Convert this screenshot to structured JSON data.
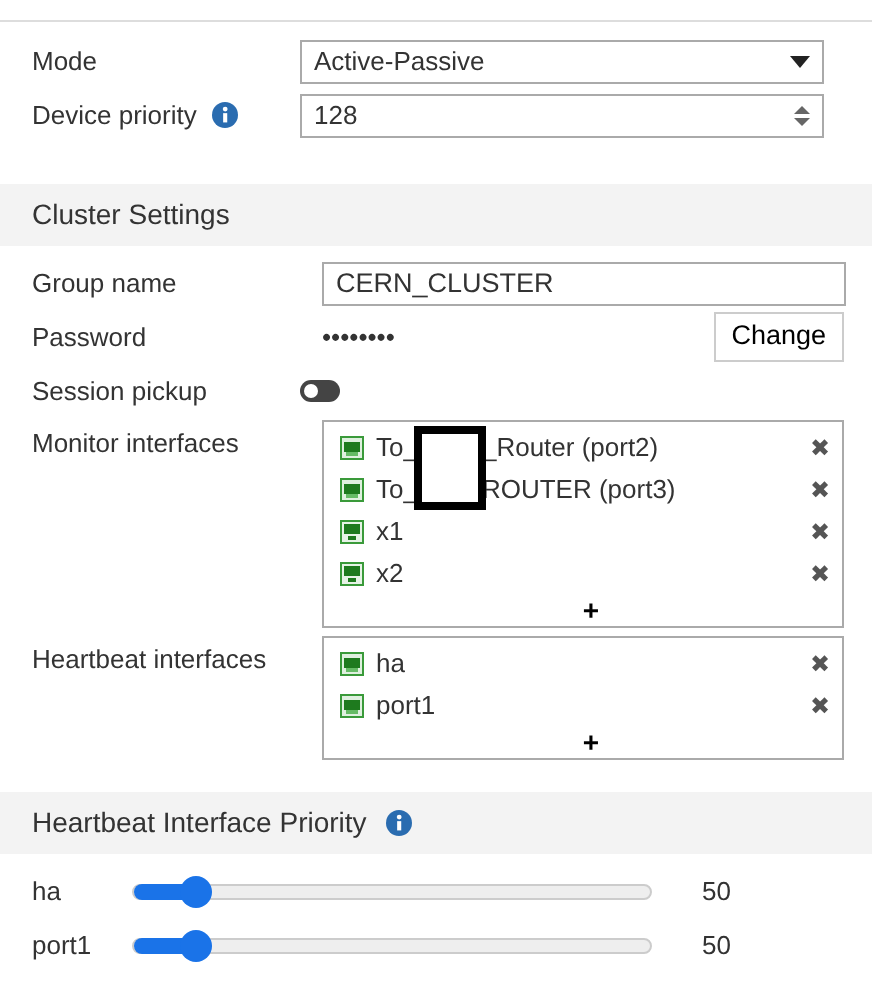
{
  "ha_settings": {
    "mode": {
      "label": "Mode",
      "value": "Active-Passive"
    },
    "device_priority": {
      "label": "Device priority",
      "value": "128"
    }
  },
  "cluster_settings": {
    "title": "Cluster Settings",
    "group_name": {
      "label": "Group name",
      "value": "CERN_CLUSTER"
    },
    "password": {
      "label": "Password",
      "value": "••••••••",
      "button": "Change"
    },
    "session_pickup": {
      "label": "Session pickup",
      "on": false
    },
    "monitor_interfaces": {
      "label": "Monitor interfaces",
      "add": "+",
      "items": [
        {
          "kind": "port",
          "before": "To_",
          "after": "_Router (port2)",
          "redacted": true,
          "remove": "✖"
        },
        {
          "kind": "port",
          "before": "To_",
          "after": "ROUTER (port3)",
          "redacted": true,
          "remove": "✖"
        },
        {
          "kind": "virtual",
          "before": "x1",
          "redacted": false,
          "remove": "✖"
        },
        {
          "kind": "virtual",
          "before": "x2",
          "redacted": false,
          "remove": "✖"
        }
      ]
    },
    "heartbeat_interfaces": {
      "label": "Heartbeat interfaces",
      "add": "+",
      "items": [
        {
          "kind": "port",
          "before": "ha",
          "redacted": false,
          "remove": "✖"
        },
        {
          "kind": "port",
          "before": "port1",
          "redacted": false,
          "remove": "✖"
        }
      ]
    }
  },
  "heartbeat_priority": {
    "title": "Heartbeat Interface Priority",
    "rows": [
      {
        "name": "ha",
        "level": 0.12,
        "reading": "50"
      },
      {
        "name": "port1",
        "level": 0.12,
        "reading": "50"
      }
    ]
  }
}
